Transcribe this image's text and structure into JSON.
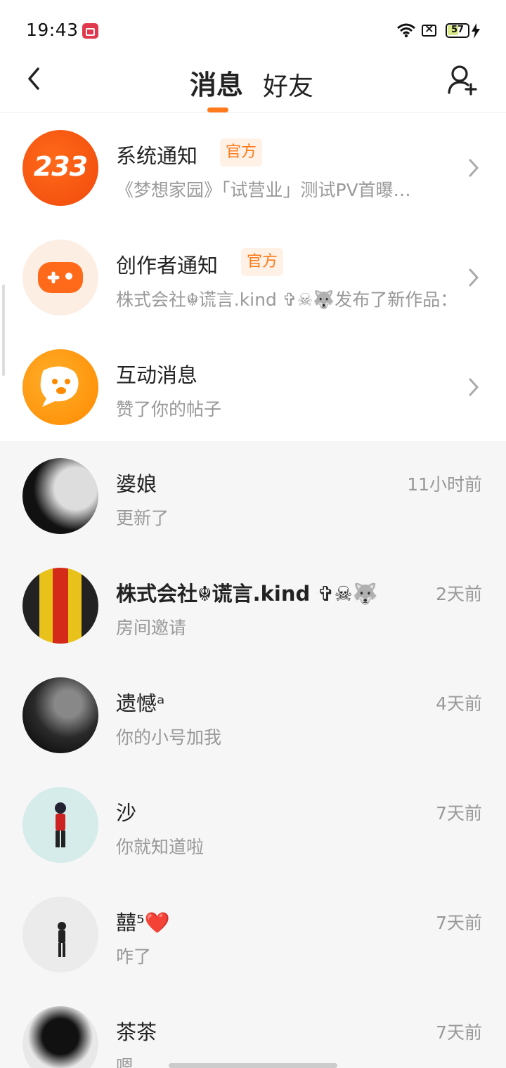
{
  "status_bar": {
    "time": "19:43",
    "battery": "57",
    "battery_fraction": 0.57
  },
  "header": {
    "tabs": [
      {
        "label": "消息",
        "active": true
      },
      {
        "label": "好友",
        "active": false
      }
    ],
    "accent_color": "#ff7a1a"
  },
  "official_items": [
    {
      "title": "系统通知",
      "badge": "官方",
      "subtitle": "《梦想家园》「试营业」测试PV首曝…",
      "avatar_text": "233",
      "icon": "brand-233-icon"
    },
    {
      "title": "创作者通知",
      "badge": "官方",
      "subtitle": "株式会社☬谎言.kind ✞☠🐺发布了新作品： …",
      "icon": "gamepad-icon"
    },
    {
      "title": "互动消息",
      "subtitle": "赞了你的帖子",
      "icon": "chat-bubble-icon"
    }
  ],
  "chats": [
    {
      "name": "婆娘",
      "time": "11小时前",
      "message": "更新了"
    },
    {
      "name": "株式会社☬谎言.kind ✞☠🐺",
      "time": "2天前",
      "message": "房间邀请"
    },
    {
      "name": "遗憾ᵃ",
      "time": "4天前",
      "message": "你的小号加我"
    },
    {
      "name": "沙",
      "time": "7天前",
      "message": "你就知道啦"
    },
    {
      "name": "囍⁵❤️",
      "time": "7天前",
      "message": "咋了"
    },
    {
      "name": "茶茶",
      "time": "7天前",
      "message": "嗯"
    }
  ]
}
